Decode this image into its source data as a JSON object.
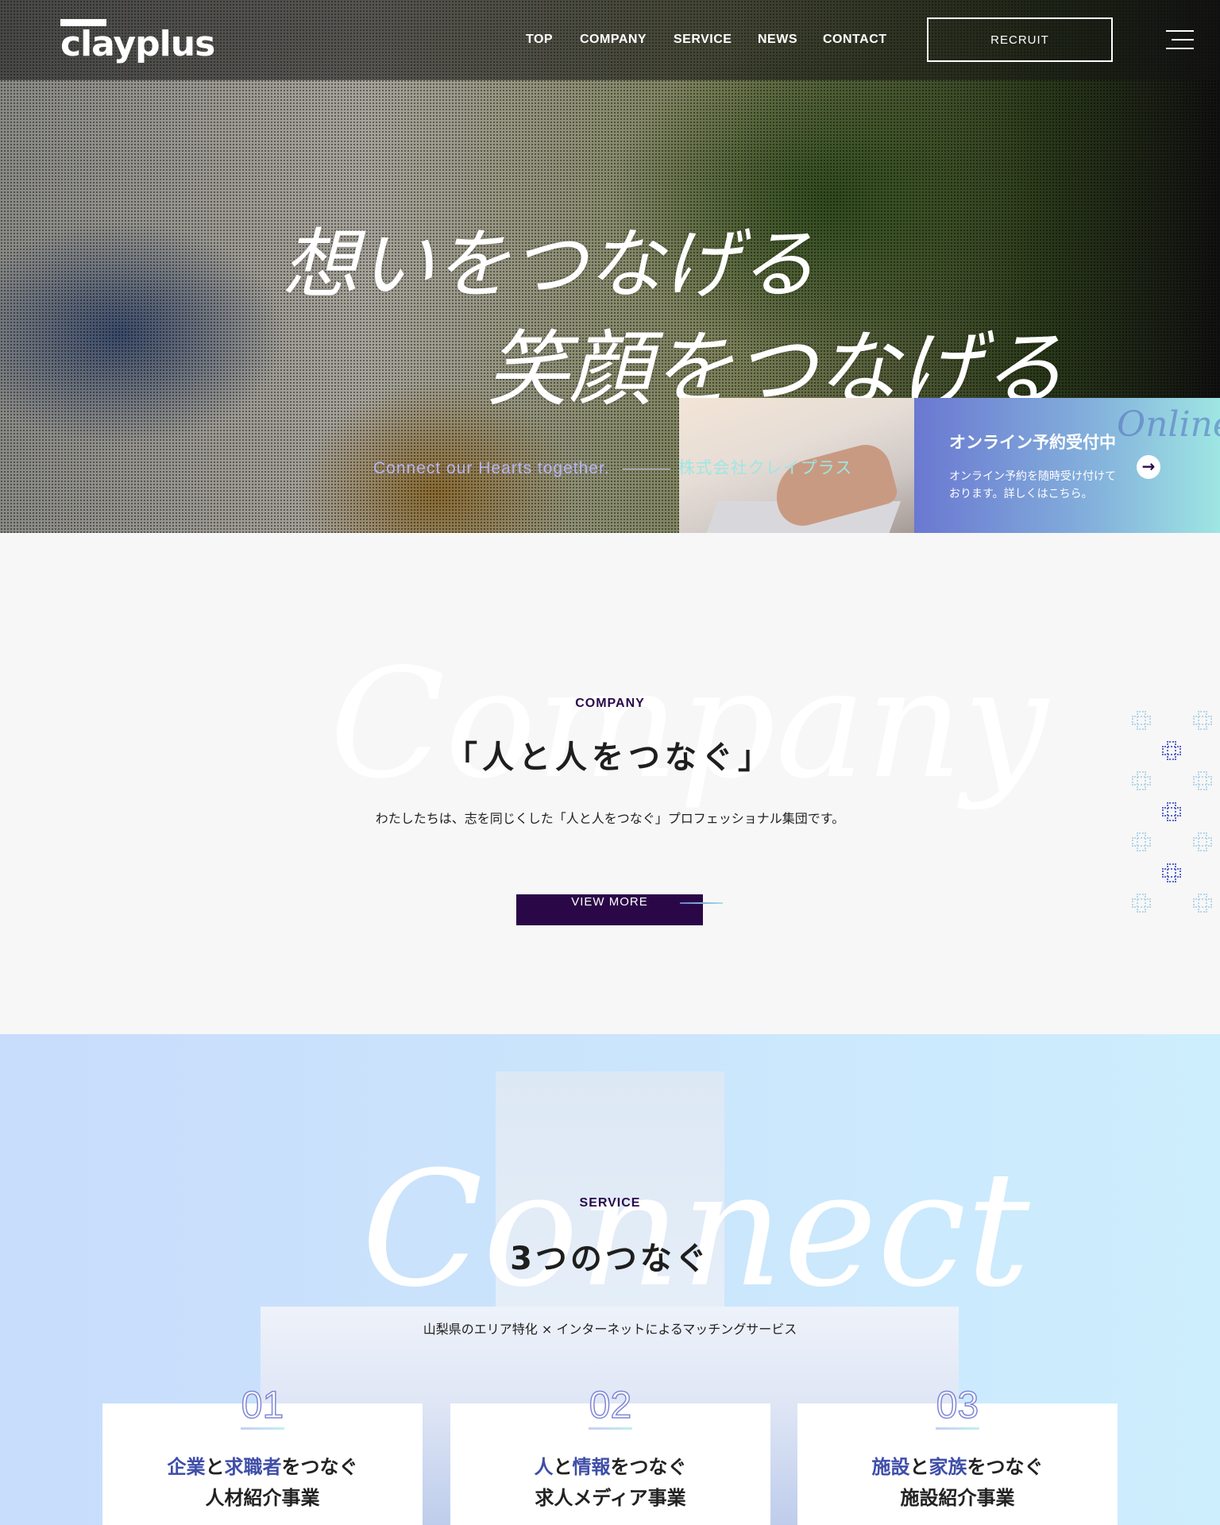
{
  "header": {
    "logo": "clayplus",
    "nav": [
      "TOP",
      "COMPANY",
      "SERVICE",
      "NEWS",
      "CONTACT"
    ],
    "recruit": "RECRUIT",
    "menu_icon": "hamburger-icon"
  },
  "hero": {
    "line1": "想いをつなげる",
    "line2": "笑顔をつなげる",
    "tagline": "Connect our Hearts together.",
    "company_name": "株式会社クレイプラス"
  },
  "online": {
    "script": "Online",
    "title": "オンライン予約受付中",
    "desc1": "オンライン予約を随時受け付けて",
    "desc2": "おります。詳しくはこちら。",
    "arrow_icon": "arrow-right-icon"
  },
  "company": {
    "script": "Company",
    "label": "COMPANY",
    "title": "「人と人をつなぐ」",
    "desc": "わたしたちは、志を同じくした「人と人をつなぐ」プロフェッショナル集団です。",
    "button": "VIEW MORE"
  },
  "service": {
    "script": "Connect",
    "label": "SERVICE",
    "title": "3つのつなぐ",
    "subtitle": "山梨県のエリア特化 × インターネットによるマッチングサービス",
    "cards": [
      {
        "num": "01",
        "a": "企業",
        "b": "と",
        "c": "求職者",
        "d": "をつなぐ",
        "name": "人材紹介事業"
      },
      {
        "num": "02",
        "a": "人",
        "b": "と",
        "c": "情報",
        "d": "をつなぐ",
        "name": "求人メディア事業"
      },
      {
        "num": "03",
        "a": "施設",
        "b": "と",
        "c": "家族",
        "d": "をつなぐ",
        "name": "施設紹介事業"
      }
    ]
  },
  "colors": {
    "brand_dark": "#2a0848",
    "accent_blue": "#3f4ea8",
    "gradient_start": "#6a78d1",
    "gradient_end": "#9ee6e3"
  }
}
